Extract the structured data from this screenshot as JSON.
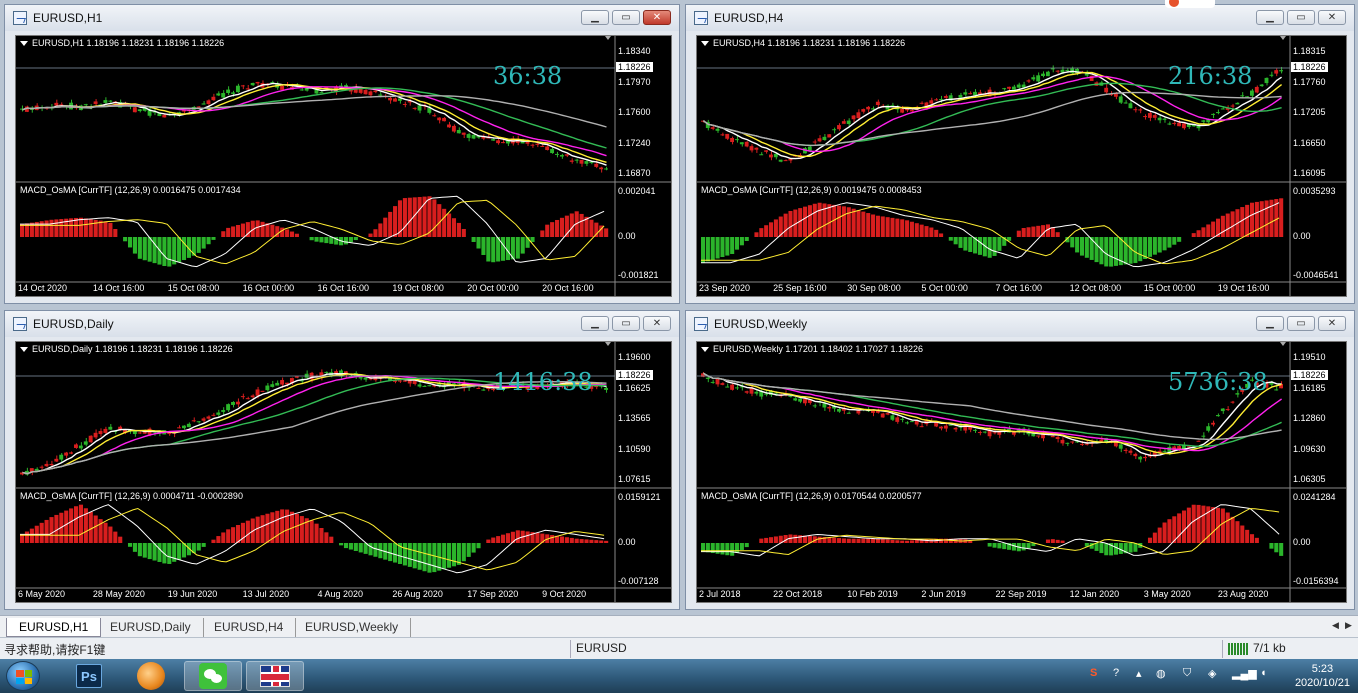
{
  "windows": [
    {
      "id": "h1",
      "title": "EURUSD,H1",
      "ohlc": "EURUSD,H1  1.18196 1.18231 1.18196 1.18226",
      "timer": "36:38",
      "price_levels": [
        "1.18340",
        "1.17970",
        "1.17600",
        "1.17240",
        "1.16870"
      ],
      "current_price": "1.18226",
      "macd_label": "MACD_OsMA [CurrTF] (12,26,9) 0.0016475 0.0017434",
      "macd_levels": [
        "0.002041",
        "0.00",
        "-0.001821"
      ],
      "x_labels": [
        "14 Oct 2020",
        "14 Oct 16:00",
        "15 Oct 08:00",
        "16 Oct 00:00",
        "16 Oct 16:00",
        "19 Oct 08:00",
        "20 Oct 00:00",
        "20 Oct 16:00"
      ],
      "active": true,
      "close_icon": "close-icon"
    },
    {
      "id": "h4",
      "title": "EURUSD,H4",
      "ohlc": "EURUSD,H4  1.18196 1.18231 1.18196 1.18226",
      "timer": "216:38",
      "price_levels": [
        "1.18315",
        "1.17760",
        "1.17205",
        "1.16650",
        "1.16095"
      ],
      "current_price": "1.18226",
      "macd_label": "MACD_OsMA [CurrTF] (12,26,9) 0.0019475 0.0008453",
      "macd_levels": [
        "0.0035293",
        "0.00",
        "-0.0046541"
      ],
      "x_labels": [
        "23 Sep 2020",
        "25 Sep 16:00",
        "30 Sep 08:00",
        "5 Oct 00:00",
        "7 Oct 16:00",
        "12 Oct 08:00",
        "15 Oct 00:00",
        "19 Oct 16:00"
      ],
      "active": false,
      "close_icon": "close-icon"
    },
    {
      "id": "daily",
      "title": "EURUSD,Daily",
      "ohlc": "EURUSD,Daily  1.18196 1.18231 1.18196 1.18226",
      "timer": "1416:38",
      "price_levels": [
        "1.19600",
        "1.16625",
        "1.13565",
        "1.10590",
        "1.07615"
      ],
      "current_price": "1.18226",
      "macd_label": "MACD_OsMA [CurrTF] (12,26,9) 0.0004711 -0.0002890",
      "macd_levels": [
        "0.0159121",
        "0.00",
        "-0.007128"
      ],
      "x_labels": [
        "6 May 2020",
        "28 May 2020",
        "19 Jun 2020",
        "13 Jul 2020",
        "4 Aug 2020",
        "26 Aug 2020",
        "17 Sep 2020",
        "9 Oct 2020"
      ],
      "active": false,
      "close_icon": "close-icon"
    },
    {
      "id": "weekly",
      "title": "EURUSD,Weekly",
      "ohlc": "EURUSD,Weekly  1.17201 1.18402 1.17027 1.18226",
      "timer": "5736:38",
      "price_levels": [
        "1.19510",
        "1.16185",
        "1.12860",
        "1.09630",
        "1.06305"
      ],
      "current_price": "1.18226",
      "macd_label": "MACD_OsMA [CurrTF] (12,26,9) 0.0170544 0.0200577",
      "macd_levels": [
        "0.0241284",
        "0.00",
        "-0.0156394"
      ],
      "x_labels": [
        "2 Jul 2018",
        "22 Oct 2018",
        "10 Feb 2019",
        "2 Jun 2019",
        "22 Sep 2019",
        "12 Jan 2020",
        "3 May 2020",
        "23 Aug 2020"
      ],
      "active": false,
      "close_icon": "close-icon"
    }
  ],
  "tabs": [
    "EURUSD,H1",
    "EURUSD,Daily",
    "EURUSD,H4",
    "EURUSD,Weekly"
  ],
  "status": {
    "help": "寻求帮助,请按F1键",
    "symbol": "EURUSD",
    "traffic": "7/1 kb"
  },
  "taskbar": {
    "time": "5:23",
    "date": "2020/10/21",
    "apps": [
      "windows-start",
      "photoshop",
      "metatrader",
      "wechat",
      "uk-flag"
    ]
  },
  "colors": {
    "bull": "#d81e1e",
    "bear": "#2bb52b",
    "ma_white": "#ffffff",
    "ma_yellow": "#ffee33",
    "ma_magenta": "#ff22ee",
    "ma_green": "#33bb55",
    "ma_gray": "#b0b0b0",
    "timer": "#2fb8b8"
  }
}
